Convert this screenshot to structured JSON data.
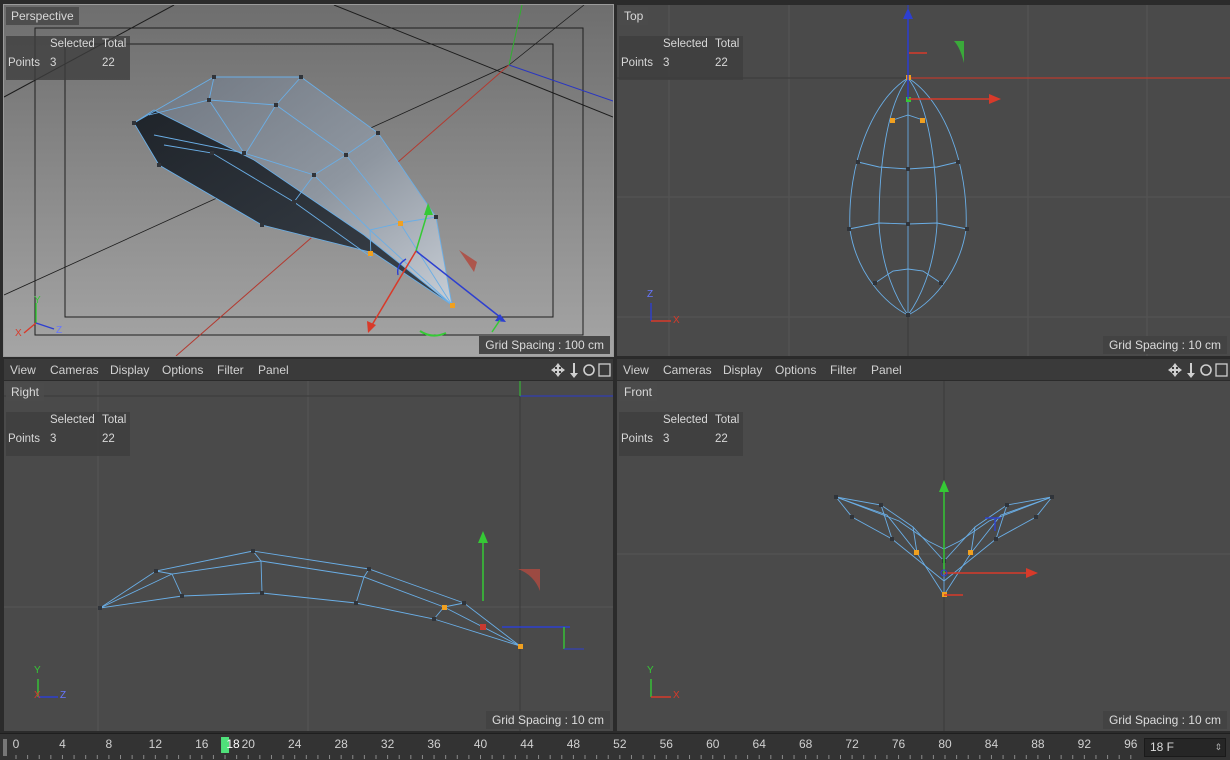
{
  "viewports": {
    "perspective": {
      "label": "Perspective",
      "grid_spacing": "Grid Spacing : 100 cm"
    },
    "top": {
      "label": "Top",
      "grid_spacing": "Grid Spacing : 10 cm"
    },
    "right": {
      "label": "Right",
      "grid_spacing": "Grid Spacing : 10 cm"
    },
    "front": {
      "label": "Front",
      "grid_spacing": "Grid Spacing : 10 cm"
    }
  },
  "hud": {
    "col_selected": "Selected",
    "col_total": "Total",
    "row_label": "Points",
    "selected": "3",
    "total": "22"
  },
  "menu": {
    "view": "View",
    "cameras": "Cameras",
    "display": "Display",
    "options": "Options",
    "filter": "Filter",
    "panel": "Panel"
  },
  "axes": {
    "x": "X",
    "y": "Y",
    "z": "Z"
  },
  "timeline": {
    "ticks": [
      "0",
      "4",
      "8",
      "12",
      "16",
      "20",
      "24",
      "28",
      "32",
      "36",
      "40",
      "44",
      "48",
      "52",
      "56",
      "60",
      "64",
      "68",
      "72",
      "76",
      "80",
      "84",
      "88",
      "92",
      "96"
    ],
    "current_frame": "18",
    "frame_field": "18 F"
  },
  "colors": {
    "axis_x": "#d83a2a",
    "axis_y": "#35c935",
    "axis_z": "#2d3fd0",
    "mesh": "#6aaee6",
    "selected_point": "#f0a020",
    "playhead": "#4fe07a"
  }
}
